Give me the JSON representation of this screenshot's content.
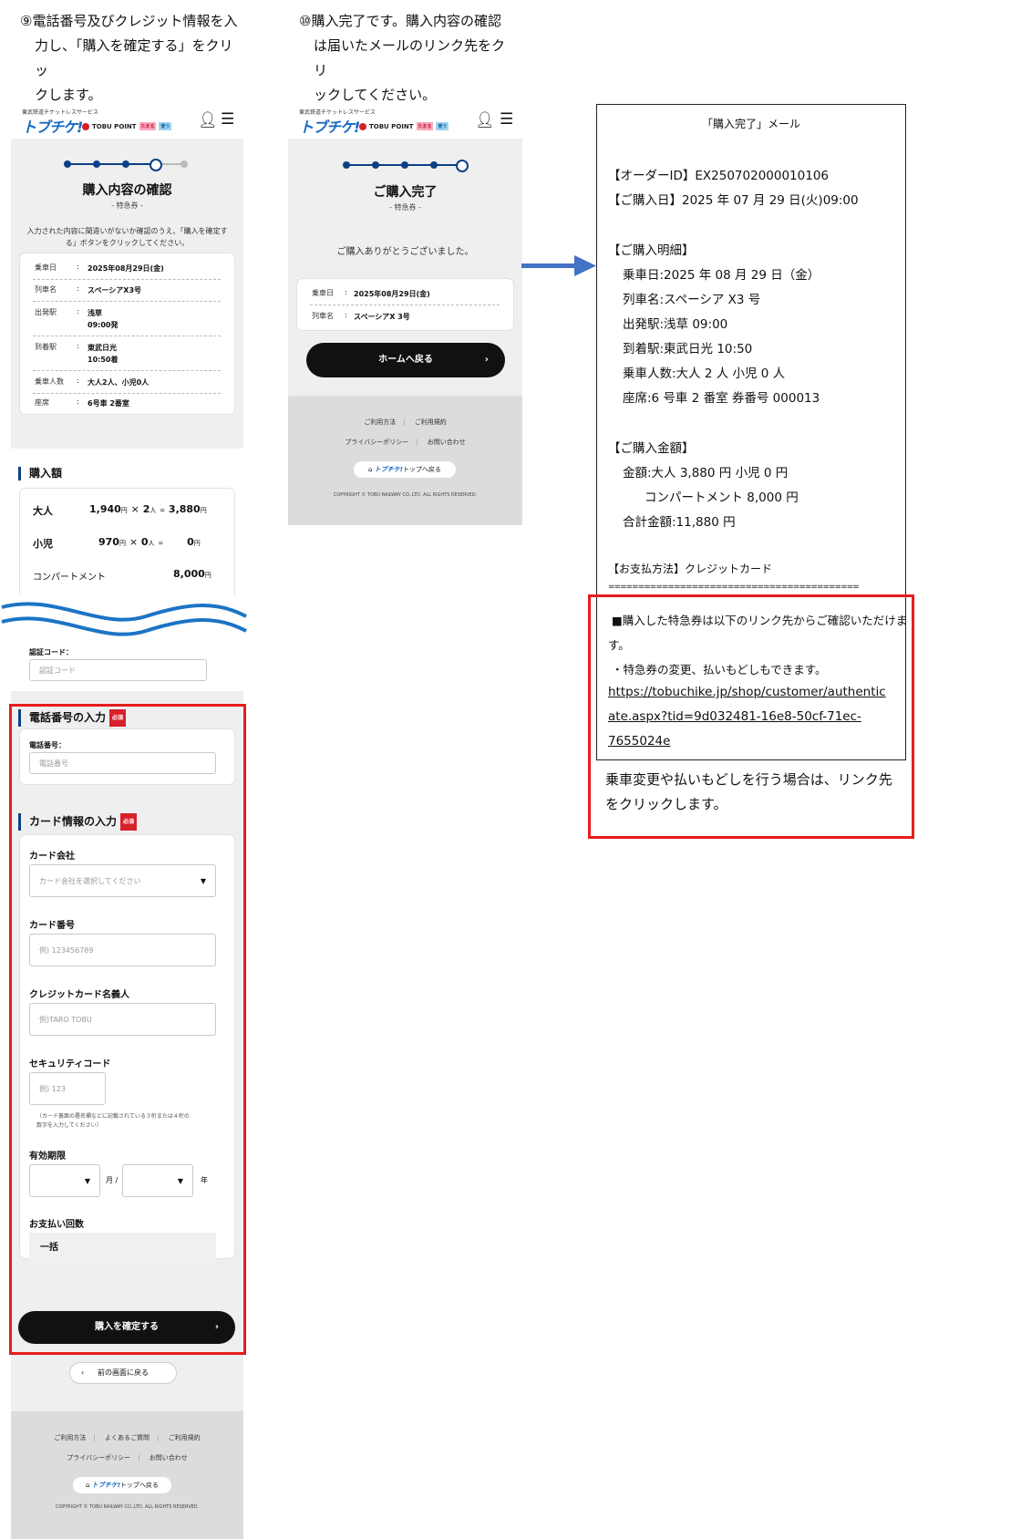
{
  "step9": {
    "lines": [
      "⑨電話番号及びクレジット情報を入",
      "力し、「購入を確定する」をクリッ",
      "クします。"
    ]
  },
  "step10": {
    "lines": [
      "⑩購入完了です。購入内容の確認",
      "は届いたメールのリンク先をクリ",
      "ックしてください。"
    ]
  },
  "brand": {
    "subtitle": "東武鉄道チケットレスサービス",
    "logo": "トブチケ!",
    "point": "TOBU POINT",
    "tag_save": "たまる",
    "tag_use": "使う"
  },
  "confirm": {
    "title": "購入内容の確認",
    "subtitle": "- 特急券 -",
    "note_line1": "入力された内容に間違いがないか確認のうえ、「購入を確定す",
    "note_line2": "る」ボタンをクリックしてください。",
    "details": [
      {
        "k": "乗車日",
        "v": "2025年08月29日(金)"
      },
      {
        "k": "列車名",
        "v": "スペーシアX3号"
      },
      {
        "k": "出発駅",
        "v": "浅草",
        "v2": "09:00発"
      },
      {
        "k": "到着駅",
        "v": "東武日光",
        "v2": "10:50着"
      },
      {
        "k": "乗車人数",
        "v": "大人2人、小児0人"
      },
      {
        "k": "座席",
        "v": "6号車 2番室"
      }
    ],
    "colon": ":",
    "price_heading": "購入額",
    "prices": {
      "adult": {
        "label": "大人",
        "unit": "1,940",
        "qty": "2",
        "total": "3,880"
      },
      "child": {
        "label": "小児",
        "unit": "970",
        "qty": "0",
        "total": "0"
      },
      "compartment": {
        "label": "コンパートメント",
        "total": "8,000"
      },
      "yen": "円",
      "times": "×",
      "people": "人",
      "eq": "="
    },
    "auth_label": "認証コード：",
    "auth_placeholder": "認証コード",
    "phone_heading": "電話番号の入力",
    "required": "必須",
    "phone_label": "電話番号：",
    "phone_placeholder": "電話番号",
    "card_heading": "カード情報の入力",
    "card_company_label": "カード会社",
    "card_company_placeholder": "カード会社を選択してください",
    "card_number_label": "カード番号",
    "card_number_placeholder": "例) 123456789",
    "card_holder_label": "クレジットカード名義人",
    "card_holder_placeholder": "例)TARO TOBU",
    "security_label": "セキュリティコード",
    "security_placeholder": "例) 123",
    "security_note1": "（カード裏面の署名欄などに記載されている３桁または４桁の",
    "security_note2": "数字を入力してください）",
    "expiry_label": "有効期限",
    "month_suffix": "月 /",
    "year_suffix": "年",
    "installments_label": "お支払い回数",
    "installments_value": "一括",
    "confirm_button": "購入を確定する",
    "back_button": "前の画面に戻る"
  },
  "footer": {
    "link_usage": "ご利用方法",
    "link_faq": "よくあるご質問",
    "link_terms": "ご利用規約",
    "link_privacy": "プライバシーポリシー",
    "link_contact": "お問い合わせ",
    "top_button_logo": "トブチケ!",
    "top_button_text": "トップへ戻る",
    "copyright": "COPYRIGHT © TOBU RAILWAY CO.,LTD. ALL RIGHTS RESERVED."
  },
  "complete": {
    "title": "ご購入完了",
    "subtitle": "- 特急券 -",
    "thanks": "ご購入ありがとうございました。",
    "details": [
      {
        "k": "乗車日",
        "v": "2025年08月29日(金)"
      },
      {
        "k": "列車名",
        "v": "スペーシアX 3号"
      }
    ],
    "home_button": "ホームへ戻る"
  },
  "mail": {
    "title": "「購入完了」メール",
    "order_id": "【オーダーID】EX250702000010106",
    "purchase_date": "【ご購入日】2025 年 07 月 29 日(火)09:00",
    "details_heading": "【ご購入明細】",
    "ride_date": "乗車日:2025 年 08 月 29 日（金）",
    "train": "列車名:スペーシア X3 号",
    "depart": "出発駅:浅草 09:00",
    "arrive": "到着駅:東武日光 10:50",
    "passengers": "乗車人数:大人 2 人 小児 0 人",
    "seat": "座席:6 号車 2 番室 券番号 000013",
    "amount_heading": "【ご購入金額】",
    "amount": "金額:大人 3,880 円 小児 0 円",
    "compartment": "コンパートメント 8,000 円",
    "total": "合計金額:11,880 円",
    "payment": "【お支払方法】クレジットカード",
    "divider": "==========================================",
    "link_note1": "■購入した特急券は以下のリンク先からご確認いただけま",
    "link_note2": "す。",
    "link_note3": "・特急券の変更、払いもどしもできます。",
    "link_url1": "https://tobuchike.jp/shop/customer/authentic",
    "link_url2": "ate.aspx?tid=9d032481-16e8-50cf-71ec-",
    "link_url3": "7655024e"
  },
  "callout": {
    "line1": "乗車変更や払いもどしを行う場合は、リンク先",
    "line2": "をクリックします。"
  }
}
